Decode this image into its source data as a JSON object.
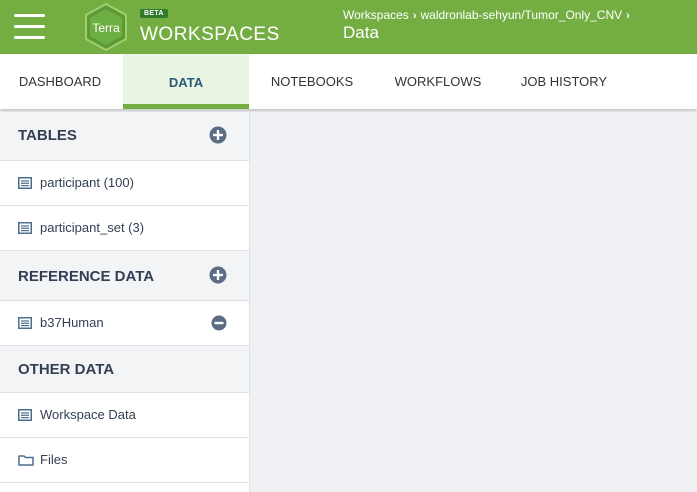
{
  "header": {
    "beta": "BETA",
    "logo_text": "Terra",
    "brand": "WORKSPACES",
    "breadcrumbs": [
      "Workspaces",
      "waldronlab-sehyun/Tumor_Only_CNV"
    ],
    "separator": "›",
    "title": "Data",
    "color": "#74ae43"
  },
  "tabs": [
    {
      "label": "DASHBOARD",
      "active": false
    },
    {
      "label": "DATA",
      "active": true
    },
    {
      "label": "NOTEBOOKS",
      "active": false
    },
    {
      "label": "WORKFLOWS",
      "active": false
    },
    {
      "label": "JOB HISTORY",
      "active": false
    }
  ],
  "sidebar": {
    "tables": {
      "title": "TABLES",
      "items": [
        "participant (100)",
        "participant_set (3)"
      ]
    },
    "reference": {
      "title": "REFERENCE DATA",
      "items": [
        "b37Human"
      ]
    },
    "other": {
      "title": "OTHER DATA",
      "items": [
        "Workspace Data",
        "Files"
      ]
    }
  },
  "icons": {
    "menu": "hamburger-icon",
    "table": "table-icon",
    "folder": "folder-icon",
    "add": "plus-circle-icon",
    "remove": "minus-circle-icon"
  }
}
